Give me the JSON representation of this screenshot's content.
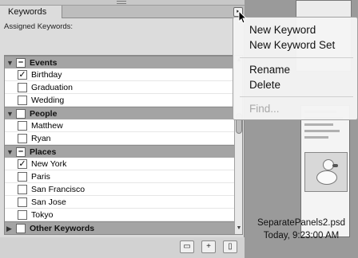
{
  "panel": {
    "tab_label": "Keywords",
    "assigned_label": "Assigned Keywords:",
    "menu_arrow_glyph": "▸"
  },
  "keywords": [
    {
      "type": "category",
      "label": "Events",
      "expanded": true,
      "check": "–"
    },
    {
      "type": "keyword",
      "label": "Birthday",
      "checked": true,
      "check": "✓"
    },
    {
      "type": "keyword",
      "label": "Graduation",
      "checked": false,
      "check": ""
    },
    {
      "type": "keyword",
      "label": "Wedding",
      "checked": false,
      "check": ""
    },
    {
      "type": "category",
      "label": "People",
      "expanded": true,
      "check": ""
    },
    {
      "type": "keyword",
      "label": "Matthew",
      "checked": false,
      "check": ""
    },
    {
      "type": "keyword",
      "label": "Ryan",
      "checked": false,
      "check": ""
    },
    {
      "type": "category",
      "label": "Places",
      "expanded": true,
      "check": "–"
    },
    {
      "type": "keyword",
      "label": "New York",
      "checked": true,
      "check": "✓"
    },
    {
      "type": "keyword",
      "label": "Paris",
      "checked": false,
      "check": ""
    },
    {
      "type": "keyword",
      "label": "San Francisco",
      "checked": false,
      "check": ""
    },
    {
      "type": "keyword",
      "label": "San Jose",
      "checked": false,
      "check": ""
    },
    {
      "type": "keyword",
      "label": "Tokyo",
      "checked": false,
      "check": ""
    },
    {
      "type": "category",
      "label": "Other Keywords",
      "expanded": false,
      "check": ""
    }
  ],
  "menu": {
    "new_keyword": "New Keyword",
    "new_keyword_set": "New Keyword Set",
    "rename": "Rename",
    "delete": "Delete",
    "find": "Find..."
  },
  "icons": {
    "expanded": "▼",
    "collapsed": "▶",
    "scroll_up": "▲",
    "scroll_down": "▼"
  },
  "file_info": {
    "name": "SeparatePanels2.psd",
    "date": "Today, 9:23:00 AM"
  },
  "colors": {
    "panel_bg": "#dcdcdc",
    "category_row": "#a4a4a4",
    "desktop_bg": "#9a9a9a"
  }
}
